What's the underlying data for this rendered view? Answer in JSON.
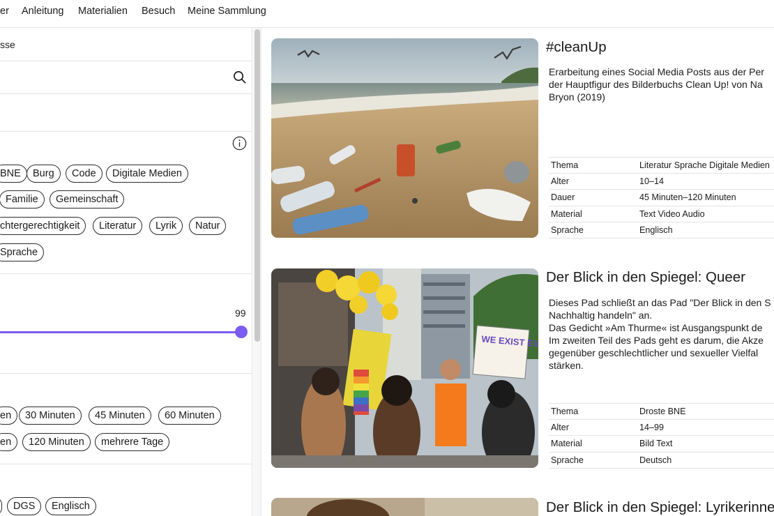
{
  "nav": {
    "items": [
      "er",
      "Anleitung",
      "Materialien",
      "Besuch",
      "Meine Sammlung"
    ]
  },
  "filters": {
    "class_label": "sse",
    "search": {
      "value": "",
      "placeholder": ""
    },
    "topics": [
      "BNE",
      "Burg",
      "Code",
      "Digitale Medien",
      "Familie",
      "Gemeinschaft",
      "chtergerechtigkeit",
      "Literatur",
      "Lyrik",
      "Natur",
      "Sprache"
    ],
    "age_slider": {
      "max_label": "99",
      "upper_value": 99
    },
    "durations": [
      "en",
      "30 Minuten",
      "45 Minuten",
      "60 Minuten",
      "en",
      "120 Minuten",
      "mehrere Tage"
    ],
    "languages": [
      "",
      "DGS",
      "Englisch"
    ]
  },
  "cards": [
    {
      "title": "#cleanUp",
      "description": "Erarbeitung eines Social Media Posts aus der Per\nder Hauptfigur des Bilderbuchs Clean Up! von Na\nBryon (2019)",
      "meta": [
        {
          "key": "Thema",
          "value": "Literatur Sprache Digitale Medien"
        },
        {
          "key": "Alter",
          "value": "10–14"
        },
        {
          "key": "Dauer",
          "value": "45 Minuten–120 Minuten"
        },
        {
          "key": "Material",
          "value": "Text Video Audio"
        },
        {
          "key": "Sprache",
          "value": "Englisch"
        }
      ]
    },
    {
      "title": "Der Blick in den Spiegel: Queer",
      "description": "Dieses Pad schließt an das Pad \"Der Blick in den S\nNachhaltig handeln\" an.\nDas Gedicht »Am Thurme« ist Ausgangspunkt de\nIm zweiten Teil des Pads geht es darum, die Akze\ngegenüber geschlechtlicher und sexueller Vielfal\nstärken.",
      "sign_text": "WE EXIST EVERYWHERE",
      "meta": [
        {
          "key": "Thema",
          "value": "Droste BNE"
        },
        {
          "key": "Alter",
          "value": "14–99"
        },
        {
          "key": "Material",
          "value": "Bild Text"
        },
        {
          "key": "Sprache",
          "value": "Deutsch"
        }
      ]
    },
    {
      "title": "Der Blick in den Spiegel: Lyrikerinne"
    }
  ]
}
